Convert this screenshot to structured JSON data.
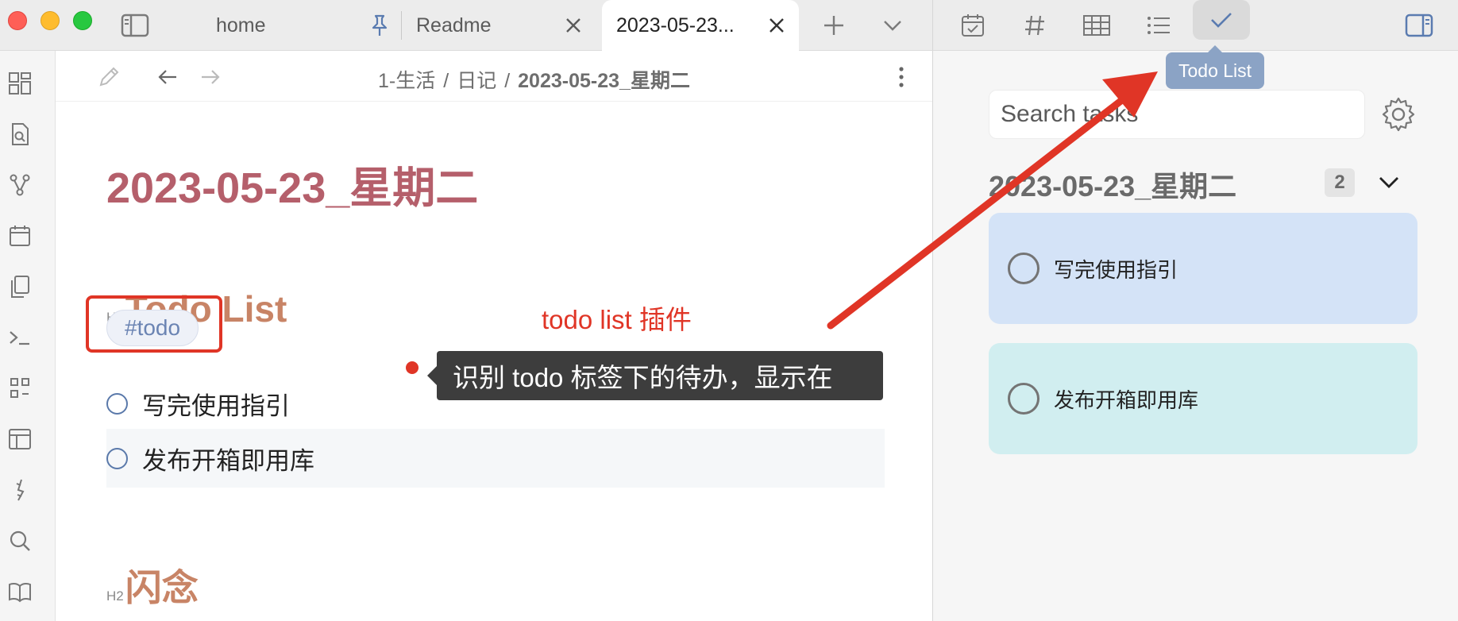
{
  "tabs": [
    {
      "label": "home"
    },
    {
      "label": "Readme"
    },
    {
      "label": "2023-05-23..."
    }
  ],
  "breadcrumb": {
    "part1": "1-生活",
    "part2": "日记",
    "current": "2023-05-23_星期二",
    "sep": "/"
  },
  "document": {
    "title": "2023-05-23_星期二",
    "h2_badge": "H2",
    "section1": "Todo List",
    "tag": "#todo",
    "todos": [
      "写完使用指引",
      "发布开箱即用库"
    ],
    "section2": "闪念"
  },
  "annotations": {
    "plugin_label": "todo list 插件",
    "callout": "识别 todo 标签下的待办，显示在"
  },
  "right_panel": {
    "tooltip": "Todo List",
    "search_placeholder": "Search tasks",
    "group_title": "2023-05-23_星期二",
    "group_count": "2",
    "cards": [
      "写完使用指引",
      "发布开箱即用库"
    ]
  },
  "colors": {
    "title": "#b55f6b",
    "heading": "#c88466",
    "annotation_red": "#e03526",
    "card_blue": "#d4e3f7",
    "card_cyan": "#d1eef0",
    "tooltip": "#8ba3c5"
  },
  "icons": [
    "sidebar-toggle-icon",
    "pin-icon",
    "close-icon",
    "plus-icon",
    "chevron-down-icon",
    "calendar-check-icon",
    "hash-icon",
    "table-icon",
    "list-icon",
    "check-icon",
    "right-sidebar-icon",
    "pencil-icon",
    "back-arrow-icon",
    "forward-arrow-icon",
    "more-vertical-icon",
    "gear-icon"
  ]
}
